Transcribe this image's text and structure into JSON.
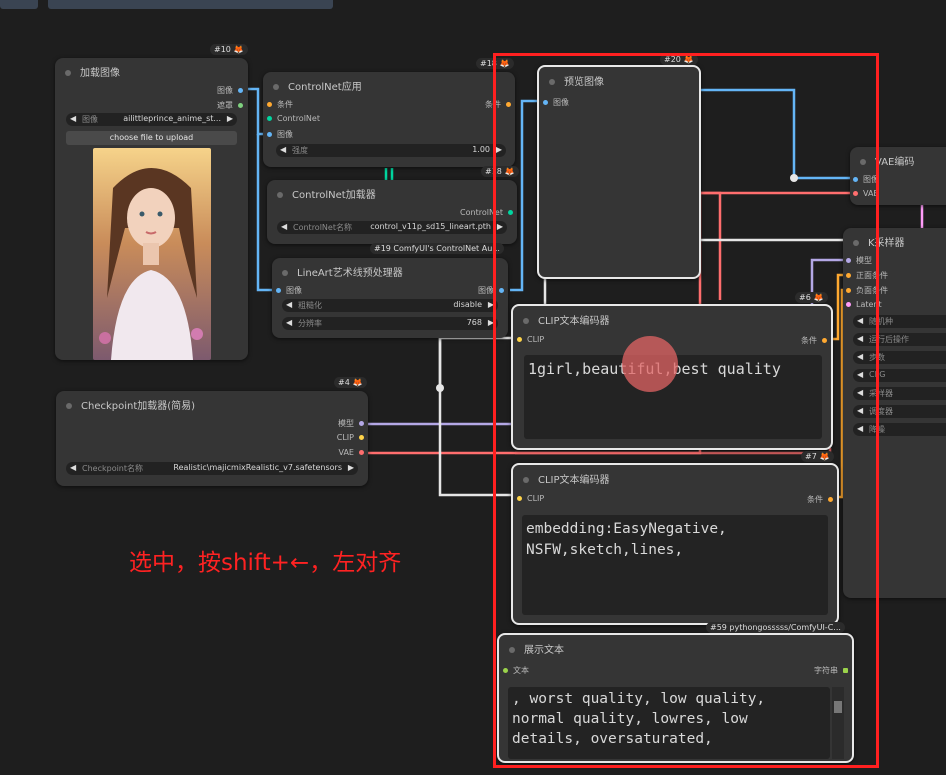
{
  "colors": {
    "selection": "#ff2020",
    "annotation": "#ff2222",
    "model": "#b4a8e6",
    "clip": "#ffd44a",
    "vae": "#ff6e6e",
    "image": "#64b5f6",
    "conditioning": "#ffa931",
    "control": "#00d6a0",
    "latent": "#ff9cf9",
    "string": "#9bd34b"
  },
  "annotation": {
    "text": "选中，按shift+←，左对齐"
  },
  "nodes": {
    "load_image": {
      "id": "#10",
      "title": "加载图像",
      "out_image": "图像",
      "out_mask": "遮罩",
      "widget_name": "图像",
      "widget_value": "ailittleprince_anime_st...",
      "upload_label": "choose file to upload"
    },
    "controlnet_apply": {
      "id": "#18",
      "title": "ControlNet应用",
      "in_cond": "条件",
      "in_controlnet": "ControlNet",
      "in_image": "图像",
      "out_cond": "条件",
      "widget_name": "强度",
      "widget_value": "1.00"
    },
    "controlnet_loader": {
      "id": "#18",
      "title": "ControlNet加载器",
      "out": "ControlNet",
      "widget_name": "ControlNet名称",
      "widget_value": "control_v11p_sd15_lineart.pth"
    },
    "lineart": {
      "id": "#19 ComfyUI's ControlNet Au...",
      "title": "LineArt艺术线预处理器",
      "in_image": "图像",
      "out_image": "图像",
      "w1_name": "粗糙化",
      "w1_value": "disable",
      "w2_name": "分辨率",
      "w2_value": "768"
    },
    "preview": {
      "id": "#20",
      "title": "预览图像",
      "in_image": "图像"
    },
    "vae_encode": {
      "title": "VAE编码",
      "in_image": "图像",
      "in_vae": "VAE"
    },
    "ksampler": {
      "title": "K采样器",
      "in_model": "模型",
      "in_pos": "正面条件",
      "in_neg": "负面条件",
      "in_latent": "Latent",
      "widgets": [
        "随机种",
        "运行后操作",
        "步数",
        "CFG",
        "采样器",
        "调度器",
        "降噪"
      ]
    },
    "checkpoint": {
      "id": "#4",
      "title": "Checkpoint加载器(简易)",
      "out_model": "模型",
      "out_clip": "CLIP",
      "out_vae": "VAE",
      "widget_name": "Checkpoint名称",
      "widget_value": "Realistic\\majicmixRealistic_v7.safetensors"
    },
    "clip_pos": {
      "id": "#6",
      "title": "CLIP文本编码器",
      "in_clip": "CLIP",
      "out": "条件",
      "text": "1girl,beautiful,best quality"
    },
    "clip_neg": {
      "id": "#7",
      "title": "CLIP文本编码器",
      "in_clip": "CLIP",
      "out": "条件",
      "text": "embedding:EasyNegative,\nNSFW,sketch,lines,"
    },
    "show_text": {
      "id": "#59 pythongosssss/ComfyUI-C...",
      "title": "展示文本",
      "in_text": "文本",
      "out": "字符串",
      "text": ", worst quality, low quality,\nnormal quality, lowres, low\ndetails, oversaturated,"
    }
  }
}
